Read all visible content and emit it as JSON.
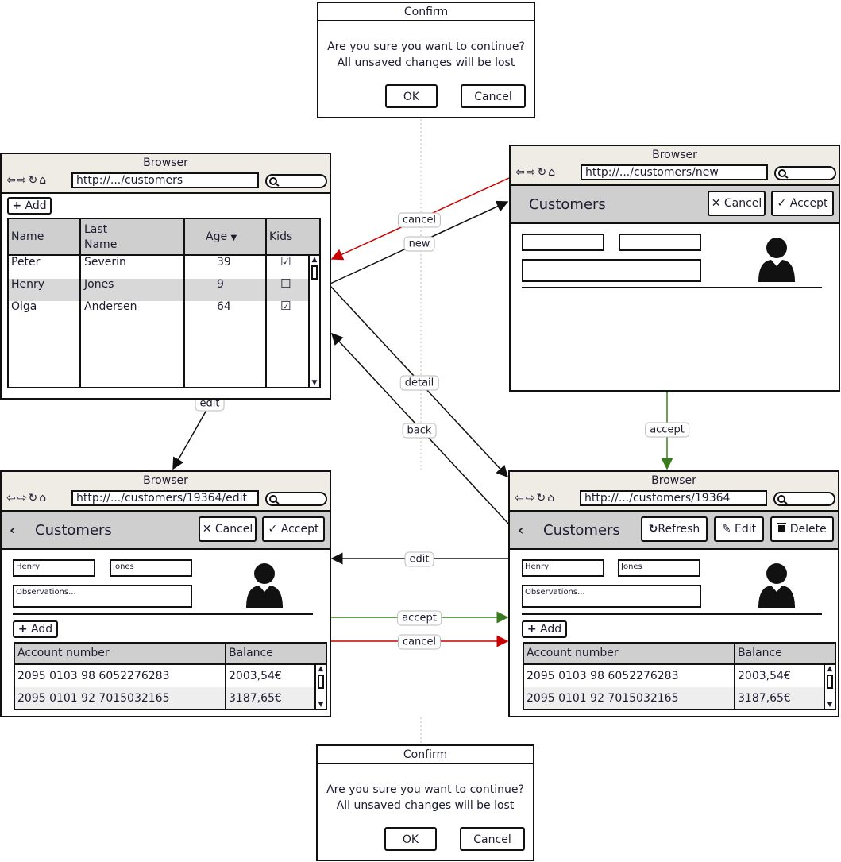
{
  "browser_title": "Browser",
  "nav_icons": [
    "back-arrow-icon",
    "forward-arrow-icon",
    "reload-icon",
    "home-icon"
  ],
  "confirm": {
    "title": "Confirm",
    "line1": "Are you sure you want to continue?",
    "line2": "All unsaved changes will be lost",
    "ok": "OK",
    "cancel": "Cancel"
  },
  "list": {
    "url": "http://.../customers",
    "add": "Add",
    "columns": [
      "Name",
      "Last\nName",
      "Age",
      "Kids"
    ],
    "rows": [
      {
        "name": "Peter",
        "last": "Severin",
        "age": "39",
        "kids": true
      },
      {
        "name": "Henry",
        "last": "Jones",
        "age": "9",
        "kids": false
      },
      {
        "name": "Olga",
        "last": "Andersen",
        "age": "64",
        "kids": true
      }
    ]
  },
  "new": {
    "url": "http://.../customers/new",
    "title": "Customers",
    "cancel": "Cancel",
    "accept": "Accept"
  },
  "edit": {
    "url": "http://.../customers/19364/edit",
    "title": "Customers",
    "cancel": "Cancel",
    "accept": "Accept",
    "first": "Henry",
    "last": "Jones",
    "obs": "Observations...",
    "add": "Add"
  },
  "detail": {
    "url": "http://.../customers/19364",
    "title": "Customers",
    "refresh": "Refresh",
    "edit": "Edit",
    "delete": "Delete",
    "first": "Henry",
    "last": "Jones",
    "obs": "Observations...",
    "add": "Add"
  },
  "accounts": {
    "columns": [
      "Account number",
      "Balance"
    ],
    "rows": [
      {
        "number": "2095 0103 98 6052276283",
        "balance": "2003,54€"
      },
      {
        "number": "2095 0101 92 7015032165",
        "balance": "3187,65€"
      }
    ]
  },
  "transitions": {
    "cancel1": "cancel",
    "new": "new",
    "detail": "detail",
    "back": "back",
    "edit1": "edit",
    "accept1": "accept",
    "edit2": "edit",
    "accept2": "accept",
    "cancel2": "cancel"
  },
  "colors": {
    "cancel": "#cc0000",
    "accept": "#3a7a1e",
    "default": "#111111",
    "header": "#cfcfcf",
    "titlebar": "#efece6"
  }
}
